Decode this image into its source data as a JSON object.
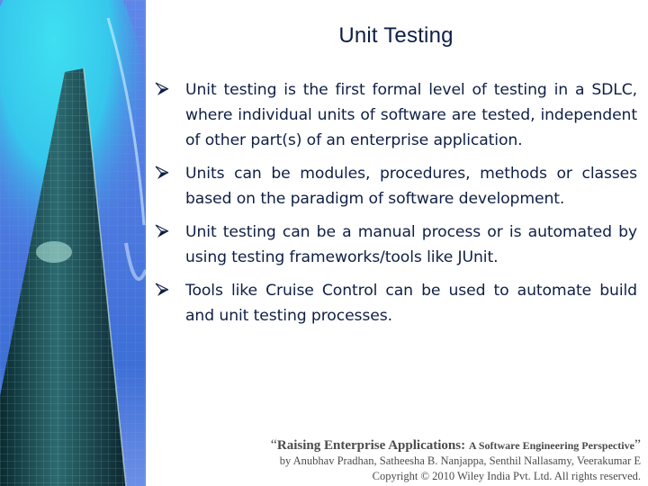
{
  "slide": {
    "title": "Unit Testing",
    "bullet_icon": "arrowhead-bullet-icon",
    "bullets": [
      {
        "text": "Unit testing is the first formal level of testing in a SDLC, where individual units of software are tested, independent of other part(s) of an enterprise application."
      },
      {
        "text": "Units can be modules, procedures, methods or classes based on the paradigm of software development."
      },
      {
        "text": "Unit testing can be a manual process or is automated by using testing frameworks/tools like JUnit."
      },
      {
        "text": "Tools like Cruise Control can be used to automate build and unit testing processes."
      }
    ],
    "side_image": "skyscraper-photo",
    "footer": {
      "open_quote": "“",
      "book_title_main": "Raising Enterprise Applications:",
      "book_title_sub": "A Software Engineering Perspective",
      "close_quote": "”",
      "authors": "by Anubhav Pradhan, Satheesha B. Nanjappa, Senthil Nallasamy, Veerakumar E",
      "copyright": "Copyright © 2010 Wiley India Pvt. Ltd.  All rights reserved."
    }
  },
  "colors": {
    "text": "#0f1f45",
    "footer_text": "#4b4b4b",
    "background": "#ffffff"
  }
}
